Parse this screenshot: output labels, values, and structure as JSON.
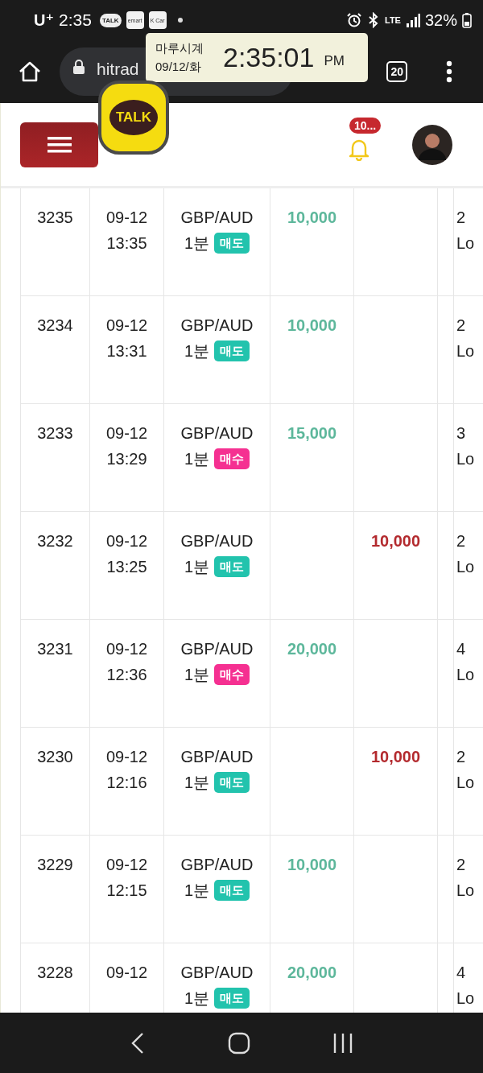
{
  "status_bar": {
    "carrier": "U⁺",
    "time": "2:35",
    "notification_icons": [
      {
        "label": "TALK",
        "kind": "bubble"
      },
      {
        "label": "emart",
        "kind": "tile"
      },
      {
        "label": "K Car",
        "kind": "tile"
      }
    ],
    "network": "LTE",
    "battery": "32%"
  },
  "browser": {
    "url": "hitrad",
    "tab_count": "20"
  },
  "clock_widget": {
    "title": "마루시계",
    "date": "09/12/화",
    "time": "2:35:01",
    "meridiem": "PM"
  },
  "floating_chat": {
    "label": "TALK"
  },
  "header": {
    "notification_badge": "10..."
  },
  "rows": [
    {
      "column_1": "3235",
      "date": "09-12",
      "time": "13:35",
      "pair": "GBP/AUD",
      "period": "1분",
      "side": {
        "label": "매도",
        "kind": "sell"
      },
      "column_4": "10,000",
      "column_7": "2 Lo"
    },
    {
      "column_1": "3234",
      "date": "09-12",
      "time": "13:31",
      "pair": "GBP/AUD",
      "period": "1분",
      "side": {
        "label": "매도",
        "kind": "sell"
      },
      "column_4": "10,000",
      "column_7": "2 Lo"
    },
    {
      "column_1": "3233",
      "date": "09-12",
      "time": "13:29",
      "pair": "GBP/AUD",
      "period": "1분",
      "side": {
        "label": "매수",
        "kind": "buy"
      },
      "column_4": "15,000",
      "column_7": "3 Lo"
    },
    {
      "column_1": "3232",
      "date": "09-12",
      "time": "13:25",
      "pair": "GBP/AUD",
      "period": "1분",
      "side": {
        "label": "매도",
        "kind": "sell"
      },
      "column_5": "10,000",
      "column_7": "2 Lo"
    },
    {
      "column_1": "3231",
      "date": "09-12",
      "time": "12:36",
      "pair": "GBP/AUD",
      "period": "1분",
      "side": {
        "label": "매수",
        "kind": "buy"
      },
      "column_4": "20,000",
      "column_7": "4 Lo"
    },
    {
      "column_1": "3230",
      "date": "09-12",
      "time": "12:16",
      "pair": "GBP/AUD",
      "period": "1분",
      "side": {
        "label": "매도",
        "kind": "sell"
      },
      "column_5": "10,000",
      "column_7": "2 Lo"
    },
    {
      "column_1": "3229",
      "date": "09-12",
      "time": "12:15",
      "pair": "GBP/AUD",
      "period": "1분",
      "side": {
        "label": "매도",
        "kind": "sell"
      },
      "column_4": "10,000",
      "column_7": "2 Lo"
    },
    {
      "column_1": "3228",
      "date": "09-12",
      "pair": "GBP/AUD",
      "period": "1분",
      "side": {
        "label": "매도",
        "kind": "sell"
      },
      "column_4": "20,000",
      "column_7": "4 Lo"
    }
  ]
}
